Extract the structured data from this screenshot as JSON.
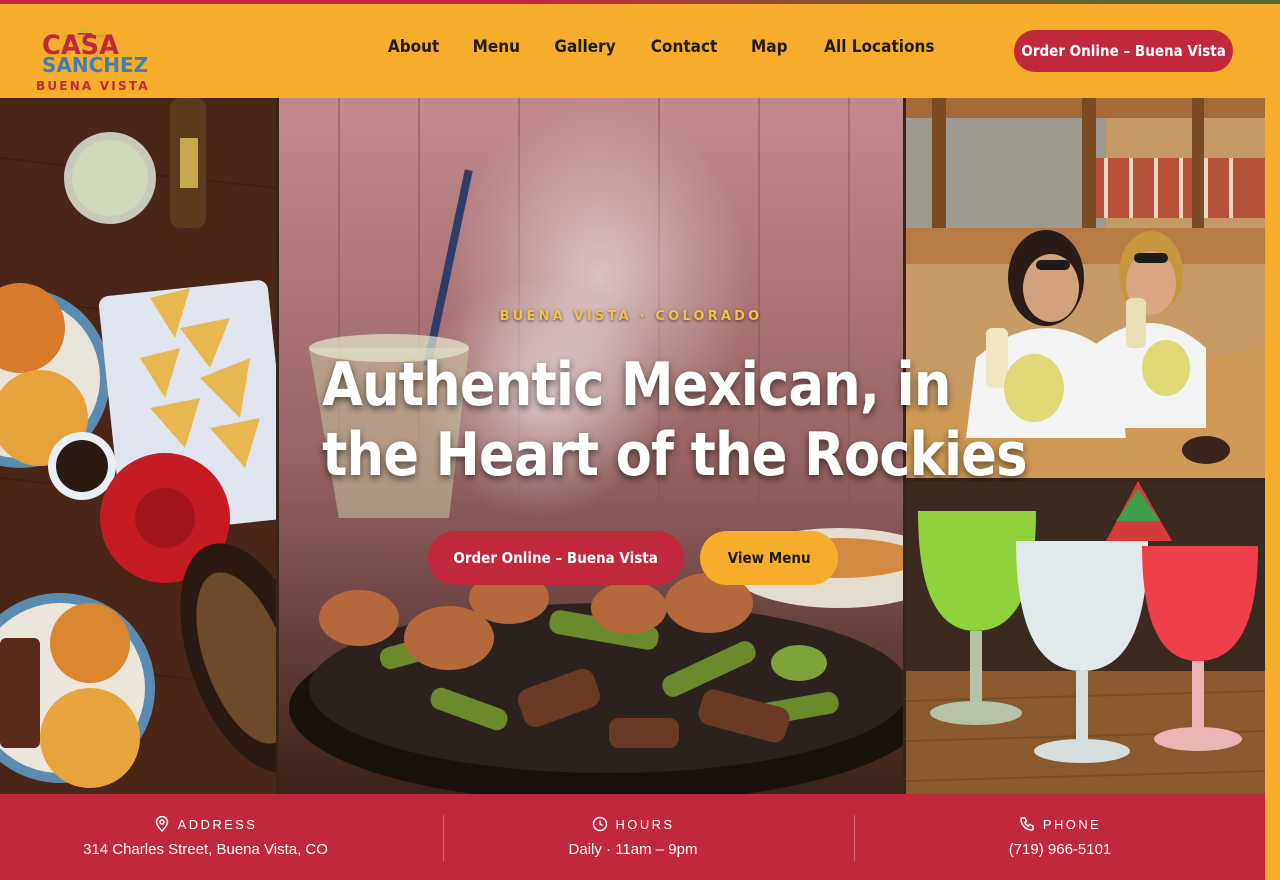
{
  "brand": {
    "logo_line1": "CASA",
    "logo_line2": "SANCHEZ",
    "logo_line3": "BUENA VISTA"
  },
  "nav": {
    "items": [
      {
        "label": "About"
      },
      {
        "label": "Menu"
      },
      {
        "label": "Gallery"
      },
      {
        "label": "Contact"
      },
      {
        "label": "Map"
      },
      {
        "label": "All Locations"
      }
    ],
    "order_button": "Order Online – Buena Vista"
  },
  "hero": {
    "kicker": "BUENA VISTA · COLORADO",
    "headline_line1": "Authentic Mexican, in",
    "headline_line2": "the Heart of the Rockies",
    "primary_button": "Order Online – Buena Vista",
    "secondary_button": "View Menu"
  },
  "info": {
    "address": {
      "label": "ADDRESS",
      "value": "314 Charles Street, Buena Vista, CO",
      "icon": "location-pin-icon"
    },
    "hours": {
      "label": "HOURS",
      "value": "Daily · 11am – 9pm",
      "icon": "clock-icon"
    },
    "phone": {
      "label": "PHONE",
      "value": "(719) 966-5101",
      "icon": "phone-icon"
    }
  },
  "colors": {
    "primary_red": "#c1283c",
    "accent_yellow": "#f5ad2b",
    "logo_blue": "#3e7fb5"
  }
}
